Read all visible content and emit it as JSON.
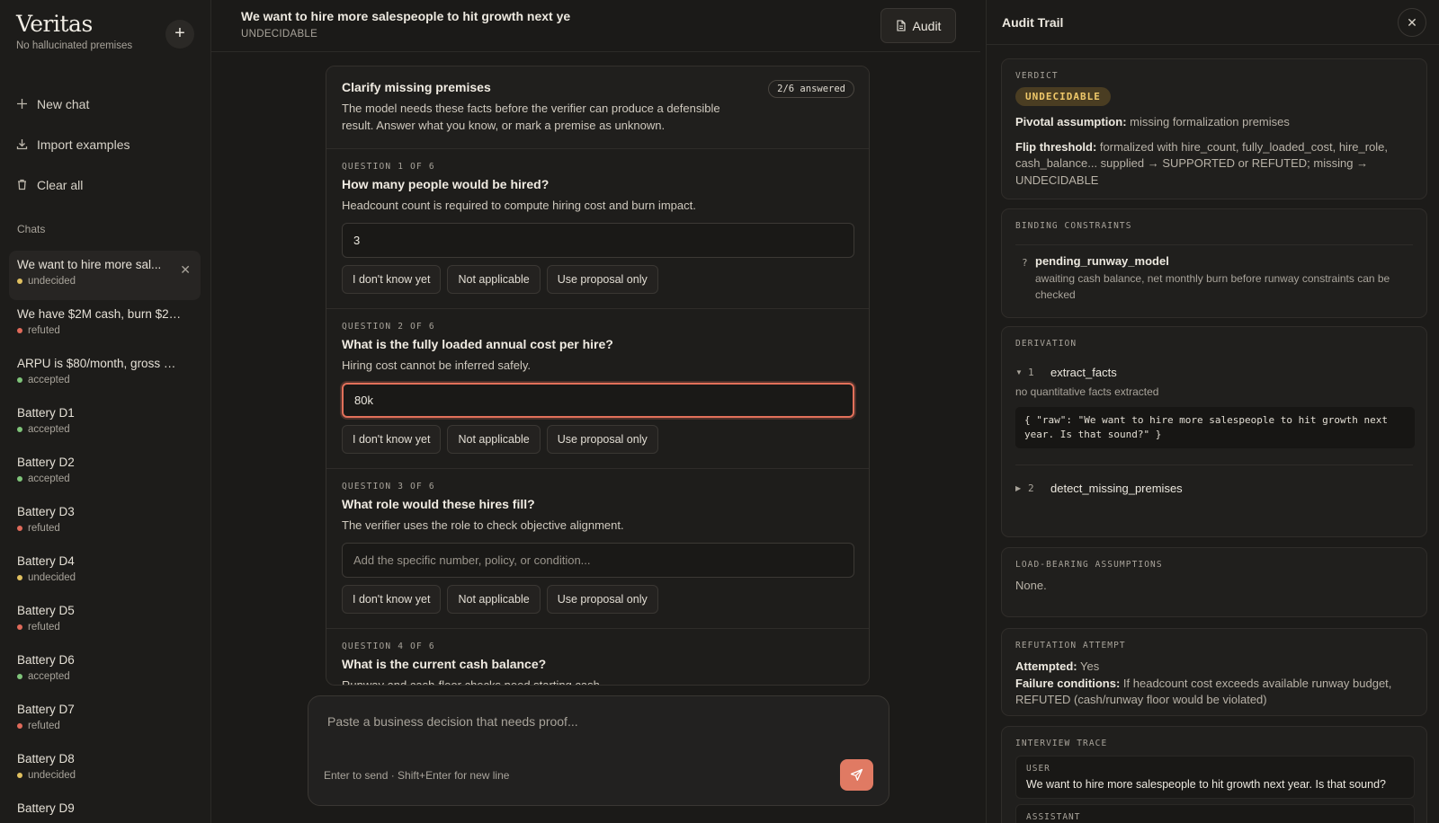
{
  "sidebar": {
    "brand_title": "Veritas",
    "brand_sub": "No hallucinated premises",
    "plus_label": "+",
    "actions": [
      {
        "label": "New chat",
        "icon": "plus-icon"
      },
      {
        "label": "Import examples",
        "icon": "download-icon"
      },
      {
        "label": "Clear all",
        "icon": "trash-icon"
      }
    ],
    "chats_label": "Chats",
    "chats": [
      {
        "title": "We want to hire more sal...",
        "status": "undecided",
        "color": "#e0c060",
        "active": true
      },
      {
        "title": "We have $2M cash, burn $25...",
        "status": "refuted",
        "color": "#e06a5a"
      },
      {
        "title": "ARPU is $80/month, gross ma...",
        "status": "accepted",
        "color": "#7fc47a"
      },
      {
        "title": "Battery D1",
        "status": "accepted",
        "color": "#7fc47a"
      },
      {
        "title": "Battery D2",
        "status": "accepted",
        "color": "#7fc47a"
      },
      {
        "title": "Battery D3",
        "status": "refuted",
        "color": "#e06a5a"
      },
      {
        "title": "Battery D4",
        "status": "undecided",
        "color": "#e0c060"
      },
      {
        "title": "Battery D5",
        "status": "refuted",
        "color": "#e06a5a"
      },
      {
        "title": "Battery D6",
        "status": "accepted",
        "color": "#7fc47a"
      },
      {
        "title": "Battery D7",
        "status": "refuted",
        "color": "#e06a5a"
      },
      {
        "title": "Battery D8",
        "status": "undecided",
        "color": "#e0c060"
      },
      {
        "title": "Battery D9",
        "status": "",
        "color": ""
      }
    ]
  },
  "main": {
    "title": "We want to hire more salespeople to hit growth next ye",
    "subtitle": "UNDECIDABLE",
    "audit_button": "Audit",
    "card": {
      "title": "Clarify missing premises",
      "desc": "The model needs these facts before the verifier can produce a defensible result. Answer what you know, or mark a premise as unknown.",
      "badge": "2/6 answered",
      "options": [
        "I don't know yet",
        "Not applicable",
        "Use proposal only"
      ],
      "questions": [
        {
          "label": "QUESTION 1 OF 6",
          "title": "How many people would be hired?",
          "desc": "Headcount count is required to compute hiring cost and burn impact.",
          "value": "3",
          "placeholder": "",
          "focused": false
        },
        {
          "label": "QUESTION 2 OF 6",
          "title": "What is the fully loaded annual cost per hire?",
          "desc": "Hiring cost cannot be inferred safely.",
          "value": "80k",
          "placeholder": "",
          "focused": true
        },
        {
          "label": "QUESTION 3 OF 6",
          "title": "What role would these hires fill?",
          "desc": "The verifier uses the role to check objective alignment.",
          "value": "",
          "placeholder": "Add the specific number, policy, or condition...",
          "focused": false
        },
        {
          "label": "QUESTION 4 OF 6",
          "title": "What is the current cash balance?",
          "desc": "Runway and cash-floor checks need starting cash.",
          "value": "",
          "placeholder": "",
          "focused": false
        }
      ]
    },
    "composer": {
      "placeholder": "Paste a business decision that needs proof...",
      "hint": "Enter to send · Shift+Enter for new line"
    }
  },
  "audit": {
    "title": "Audit Trail",
    "verdict": {
      "label": "VERDICT",
      "badge": "UNDECIDABLE",
      "pivotal_key": "Pivotal assumption:",
      "pivotal_val": "missing formalization premises",
      "flip_key": "Flip threshold:",
      "flip_val": "formalized with hire_count, fully_loaded_cost, hire_role, cash_balance... supplied → SUPPORTED or REFUTED; missing → UNDECIDABLE"
    },
    "binding": {
      "label": "BINDING CONSTRAINTS",
      "mark": "?",
      "name": "pending_runway_model",
      "desc": "awaiting cash balance, net monthly burn before runway constraints can be checked"
    },
    "derivation": {
      "label": "DERIVATION",
      "steps": [
        {
          "num": "1",
          "name": "extract_facts",
          "note": "no quantitative facts extracted",
          "code": "{ \"raw\": \"We want to hire more salespeople to hit growth next year. Is that sound?\" }",
          "expanded": true
        },
        {
          "num": "2",
          "name": "detect_missing_premises",
          "expanded": false
        }
      ]
    },
    "load_bearing": {
      "label": "LOAD-BEARING ASSUMPTIONS",
      "value": "None."
    },
    "refutation": {
      "label": "REFUTATION ATTEMPT",
      "attempted_key": "Attempted:",
      "attempted_val": "Yes",
      "failure_key": "Failure conditions:",
      "failure_val": "If headcount cost exceeds available runway budget, REFUTED (cash/runway floor would be violated)"
    },
    "trace": {
      "label": "INTERVIEW TRACE",
      "messages": [
        {
          "role": "USER",
          "text": "We want to hire more salespeople to hit growth next year. Is that sound?"
        },
        {
          "role": "ASSISTANT",
          "text": ""
        }
      ]
    }
  }
}
